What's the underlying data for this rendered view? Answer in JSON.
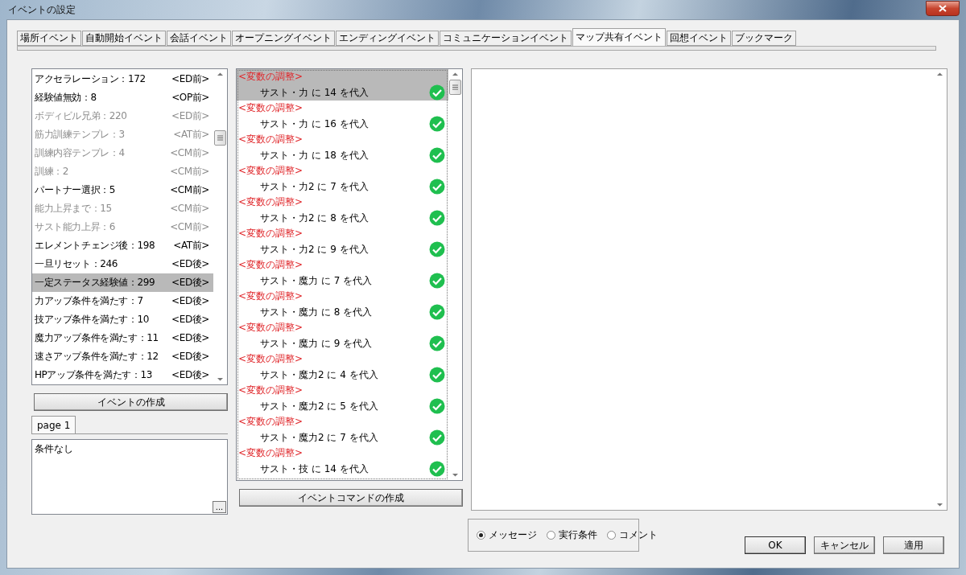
{
  "window": {
    "title": "イベントの設定"
  },
  "tabs": [
    {
      "label": "場所イベント",
      "selected": false
    },
    {
      "label": "自動開始イベント",
      "selected": false
    },
    {
      "label": "会話イベント",
      "selected": false
    },
    {
      "label": "オープニングイベント",
      "selected": false
    },
    {
      "label": "エンディングイベント",
      "selected": false
    },
    {
      "label": "コミュニケーションイベント",
      "selected": false
    },
    {
      "label": "マップ共有イベント",
      "selected": true
    },
    {
      "label": "回想イベント",
      "selected": false
    },
    {
      "label": "ブックマーク",
      "selected": false
    }
  ],
  "event_list": [
    {
      "name": "アクセラレーション：172",
      "tag": "<ED前>",
      "disabled": false,
      "selected": false
    },
    {
      "name": "経験値無効：8",
      "tag": "<OP前>",
      "disabled": false,
      "selected": false
    },
    {
      "name": "ボディビル兄弟：220",
      "tag": "<ED前>",
      "disabled": true,
      "selected": false
    },
    {
      "name": "筋力訓練テンプレ：3",
      "tag": "<AT前>",
      "disabled": true,
      "selected": false
    },
    {
      "name": "訓練内容テンプレ：4",
      "tag": "<CM前>",
      "disabled": true,
      "selected": false
    },
    {
      "name": "訓練：2",
      "tag": "<CM前>",
      "disabled": true,
      "selected": false
    },
    {
      "name": "パートナー選択：5",
      "tag": "<CM前>",
      "disabled": false,
      "selected": false
    },
    {
      "name": "能力上昇まで：15",
      "tag": "<CM前>",
      "disabled": true,
      "selected": false
    },
    {
      "name": "サスト能力上昇：6",
      "tag": "<CM前>",
      "disabled": true,
      "selected": false
    },
    {
      "name": "エレメントチェンジ後：198",
      "tag": "<AT前>",
      "disabled": false,
      "selected": false
    },
    {
      "name": "一旦リセット：246",
      "tag": "<ED後>",
      "disabled": false,
      "selected": false
    },
    {
      "name": "一定ステータス経験値：299",
      "tag": "<ED後>",
      "disabled": false,
      "selected": true
    },
    {
      "name": "力アップ条件を満たす：7",
      "tag": "<ED後>",
      "disabled": false,
      "selected": false
    },
    {
      "name": "技アップ条件を満たす：10",
      "tag": "<ED後>",
      "disabled": false,
      "selected": false
    },
    {
      "name": "魔力アップ条件を満たす：11",
      "tag": "<ED後>",
      "disabled": false,
      "selected": false
    },
    {
      "name": "速さアップ条件を満たす：12",
      "tag": "<ED後>",
      "disabled": false,
      "selected": false
    },
    {
      "name": "HPアップ条件を満たす：13",
      "tag": "<ED後>",
      "disabled": false,
      "selected": false
    }
  ],
  "create_event_button": "イベントの作成",
  "page_tabs": [
    {
      "label": "page 1",
      "selected": true
    }
  ],
  "condition_text": "条件なし",
  "ellipsis_button": "...",
  "commands": [
    {
      "header": "<変数の調整>",
      "text": "サスト・力 に 14 を代入",
      "checked": true,
      "selected": true
    },
    {
      "header": "<変数の調整>",
      "text": "サスト・力 に 16 を代入",
      "checked": true,
      "selected": false
    },
    {
      "header": "<変数の調整>",
      "text": "サスト・力 に 18 を代入",
      "checked": true,
      "selected": false
    },
    {
      "header": "<変数の調整>",
      "text": "サスト・力2 に 7 を代入",
      "checked": true,
      "selected": false
    },
    {
      "header": "<変数の調整>",
      "text": "サスト・力2 に 8 を代入",
      "checked": true,
      "selected": false
    },
    {
      "header": "<変数の調整>",
      "text": "サスト・力2 に 9 を代入",
      "checked": true,
      "selected": false
    },
    {
      "header": "<変数の調整>",
      "text": "サスト・魔力 に 7 を代入",
      "checked": true,
      "selected": false
    },
    {
      "header": "<変数の調整>",
      "text": "サスト・魔力 に 8 を代入",
      "checked": true,
      "selected": false
    },
    {
      "header": "<変数の調整>",
      "text": "サスト・魔力 に 9 を代入",
      "checked": true,
      "selected": false
    },
    {
      "header": "<変数の調整>",
      "text": "サスト・魔力2 に 4 を代入",
      "checked": true,
      "selected": false
    },
    {
      "header": "<変数の調整>",
      "text": "サスト・魔力2 に 5 を代入",
      "checked": true,
      "selected": false
    },
    {
      "header": "<変数の調整>",
      "text": "サスト・魔力2 に 7 を代入",
      "checked": true,
      "selected": false
    },
    {
      "header": "<変数の調整>",
      "text": "サスト・技 に 14 を代入",
      "checked": true,
      "selected": false
    }
  ],
  "create_command_button": "イベントコマンドの作成",
  "view_options": [
    {
      "label": "メッセージ",
      "selected": true
    },
    {
      "label": "実行条件",
      "selected": false
    },
    {
      "label": "コメント",
      "selected": false
    }
  ],
  "buttons": [
    {
      "label": "OK",
      "default": true
    },
    {
      "label": "キャンセル",
      "default": false
    },
    {
      "label": "適用",
      "default": false
    }
  ]
}
